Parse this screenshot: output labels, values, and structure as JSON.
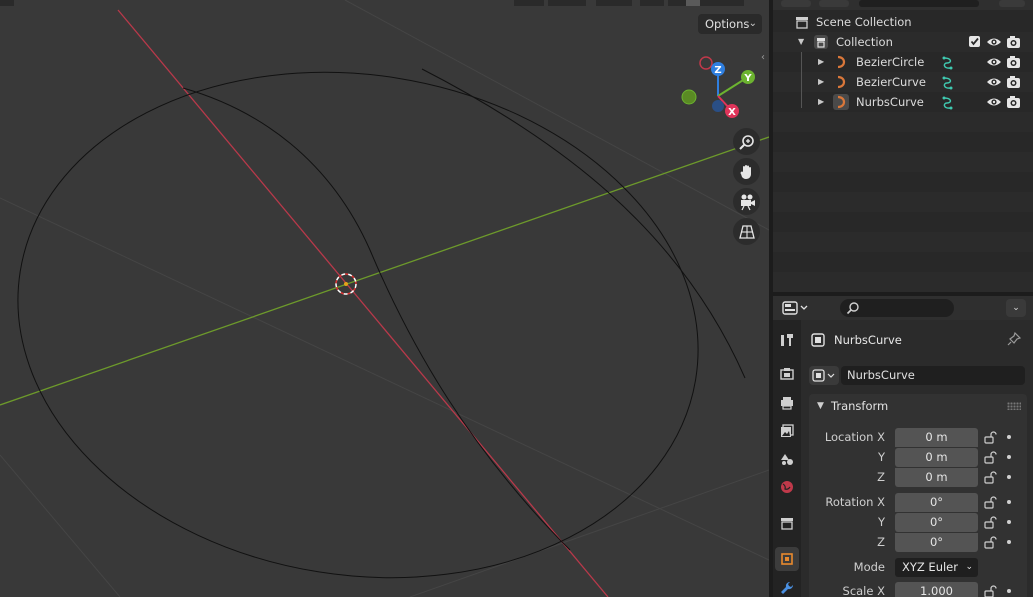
{
  "viewport": {
    "options_label": "Options"
  },
  "gizmo": {
    "z_label": "Z",
    "y_label": "Y",
    "x_label": "X"
  },
  "outliner": {
    "scene_collection": "Scene Collection",
    "collection": "Collection",
    "objects": [
      {
        "name": "BezierCircle"
      },
      {
        "name": "BezierCurve"
      },
      {
        "name": "NurbsCurve"
      }
    ]
  },
  "properties": {
    "object_name": "NurbsCurve",
    "name_field": "NurbsCurve",
    "transform_panel": {
      "title": "Transform",
      "location_label": "Location X",
      "location": [
        "0 m",
        "0 m",
        "0 m"
      ],
      "rotation_label": "Rotation X",
      "rotation": [
        "0°",
        "0°",
        "0°"
      ],
      "y_label": "Y",
      "z_label": "Z",
      "mode_label": "Mode",
      "mode_value": "XYZ Euler",
      "scale_label": "Scale X",
      "scale_x": "1.000"
    }
  },
  "colors": {
    "x_axis": "#c0394a",
    "y_axis": "#6d9a2b",
    "z_gizmo": "#2f7fe0",
    "y_gizmo": "#6cb330",
    "x_gizmo": "#e0345a",
    "curve_icon": "#d9773a",
    "modifier_icon": "#3fc9b0"
  }
}
